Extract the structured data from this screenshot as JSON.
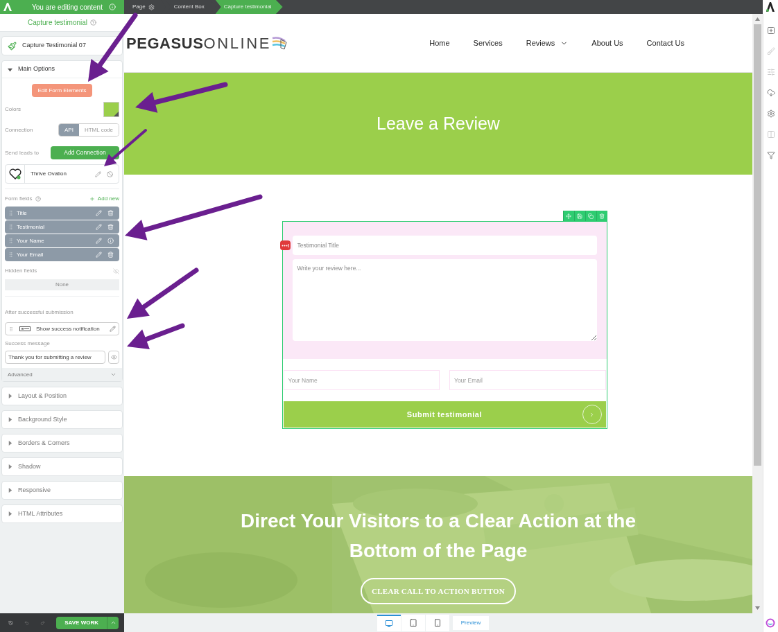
{
  "topbar": {
    "editing_label": "You are editing content",
    "breadcrumbs": [
      {
        "label": "Page",
        "selected": false,
        "kind": "page"
      },
      {
        "label": "Content Box",
        "selected": false,
        "kind": "plain"
      },
      {
        "label": "Capture testimonial",
        "selected": true,
        "kind": "plain"
      }
    ]
  },
  "sidebar": {
    "title": "Capture testimonial",
    "element_name": "Capture Testimonial 07",
    "main_options": {
      "label": "Main Options",
      "expanded": true
    },
    "edit_button": "Edit Form Elements",
    "colors_label": "Colors",
    "connection_label": "Connection",
    "connection_options": [
      {
        "label": "API",
        "selected": true
      },
      {
        "label": "HTML code",
        "selected": false
      }
    ],
    "send_leads_label": "Send leads to",
    "add_connection": "Add Connection",
    "integration_name": "Thrive Ovation",
    "form_fields_label": "Form fields",
    "add_new": "Add new",
    "fields": [
      {
        "label": "Title",
        "kind": "removable"
      },
      {
        "label": "Testimonial",
        "kind": "removable"
      },
      {
        "label": "Your Name",
        "kind": "required"
      },
      {
        "label": "Your Email",
        "kind": "removable"
      }
    ],
    "hidden_fields_label": "Hidden fields",
    "hidden_none": "None",
    "after_submission_label": "After successful submission",
    "after_submission_action": "Show success notification",
    "success_message_label": "Success message",
    "success_message_value": "Thank you for submitting a review",
    "advanced": "Advanced",
    "sections": [
      {
        "label": "Layout & Position",
        "expanded": false
      },
      {
        "label": "Background Style",
        "expanded": false
      },
      {
        "label": "Borders & Corners",
        "expanded": false
      },
      {
        "label": "Shadow",
        "expanded": false
      },
      {
        "label": "Responsive",
        "expanded": false
      },
      {
        "label": "HTML Attributes",
        "expanded": false
      }
    ],
    "save": "SAVE WORK"
  },
  "site": {
    "logo_bold": "PEGASUS",
    "logo_light": "ONLINE",
    "nav": [
      {
        "label": "Home",
        "dropdown": false
      },
      {
        "label": "Services",
        "dropdown": false
      },
      {
        "label": "Reviews",
        "dropdown": true
      },
      {
        "label": "About Us",
        "dropdown": false
      },
      {
        "label": "Contact Us",
        "dropdown": false
      }
    ],
    "hero_title": "Leave a Review",
    "form": {
      "title_placeholder": "Testimonial Title",
      "review_placeholder": "Write your review here...",
      "name_placeholder": "Your Name",
      "email_placeholder": "Your Email",
      "submit": "Submit testimonial"
    },
    "cta_title": "Direct Your Visitors to a Clear Action at the Bottom of the Page",
    "cta_button": "CLEAR CALL TO ACTION BUTTON"
  },
  "bottom_bar": {
    "devices": [
      {
        "kind": "desktop",
        "selected": true
      },
      {
        "kind": "tablet",
        "selected": false
      },
      {
        "kind": "phone",
        "selected": false
      }
    ],
    "preview": "Preview"
  }
}
